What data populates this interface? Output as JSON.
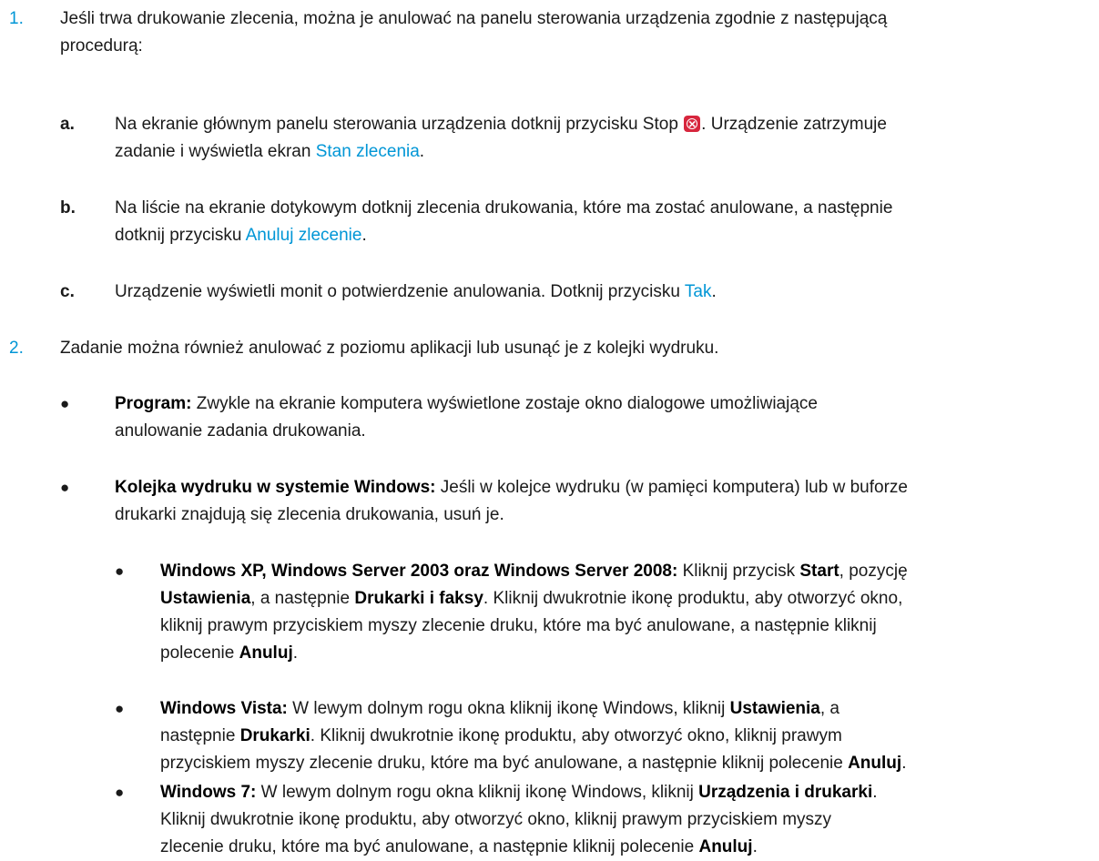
{
  "step1": {
    "num": "1.",
    "line1": "Jeśli trwa drukowanie zlecenia, można je anulować na panelu sterowania urządzenia zgodnie z następującą",
    "line2": "procedurą:",
    "a": {
      "label": "a.",
      "l1": "Na ekranie głównym panelu sterowania urządzenia dotknij przycisku Stop",
      "l1_after": ". Urządzenie zatrzymuje",
      "l2_pre": "zadanie i wyświetla ekran ",
      "l2_link": "Stan zlecenia",
      "l2_post": "."
    },
    "b": {
      "label": "b.",
      "l1": "Na liście na ekranie dotykowym dotknij zlecenia drukowania, które ma zostać anulowane, a następnie",
      "l2_pre": "dotknij przycisku ",
      "l2_link": "Anuluj zlecenie",
      "l2_post": "."
    },
    "c": {
      "label": "c.",
      "l1_pre": "Urządzenie wyświetli monit o potwierdzenie anulowania. Dotknij przycisku ",
      "l1_link": "Tak",
      "l1_post": "."
    }
  },
  "step2": {
    "num": "2.",
    "line1": "Zadanie można również anulować z poziomu aplikacji lub usunąć je z kolejki wydruku.",
    "program": {
      "bold": "Program:",
      "l1": " Zwykle na ekranie komputera wyświetlone zostaje okno dialogowe umożliwiające",
      "l2": "anulowanie zadania drukowania."
    },
    "queue": {
      "bold": "Kolejka wydruku w systemie Windows:",
      "l1": " Jeśli w kolejce wydruku (w pamięci komputera) lub w buforze",
      "l2": "drukarki znajdują się zlecenia drukowania, usuń je."
    },
    "xp": {
      "bold": "Windows XP, Windows Server 2003 oraz Windows Server 2008:",
      "l1a": " Kliknij przycisk ",
      "l1b": "Start",
      "l1c": ", pozycję",
      "l2a": "Ustawienia",
      "l2b": ", a następnie ",
      "l2c": "Drukarki i faksy",
      "l2d": ". Kliknij dwukrotnie ikonę produktu, aby otworzyć okno,",
      "l3": "kliknij prawym przyciskiem myszy zlecenie druku, które ma być anulowane, a następnie kliknij",
      "l4a": "polecenie ",
      "l4b": "Anuluj",
      "l4c": "."
    },
    "vista": {
      "bold": "Windows Vista:",
      "l1a": " W lewym dolnym rogu okna kliknij ikonę Windows, kliknij ",
      "l1b": "Ustawienia",
      "l1c": ", a",
      "l2a": "następnie ",
      "l2b": "Drukarki",
      "l2c": ". Kliknij dwukrotnie ikonę produktu, aby otworzyć okno, kliknij prawym",
      "l3a": "przyciskiem myszy zlecenie druku, które ma być anulowane, a następnie kliknij polecenie ",
      "l3b": "Anuluj",
      "l3c": "."
    },
    "win7": {
      "bold": "Windows 7:",
      "l1a": " W lewym dolnym rogu okna kliknij ikonę Windows, kliknij ",
      "l1b": "Urządzenia i drukarki",
      "l1c": ".",
      "l2": "Kliknij dwukrotnie ikonę produktu, aby otworzyć okno, kliknij prawym przyciskiem myszy",
      "l3a": "zlecenie druku, które ma być anulowane, a następnie kliknij polecenie ",
      "l3b": "Anuluj",
      "l3c": "."
    },
    "bullet": "●"
  }
}
